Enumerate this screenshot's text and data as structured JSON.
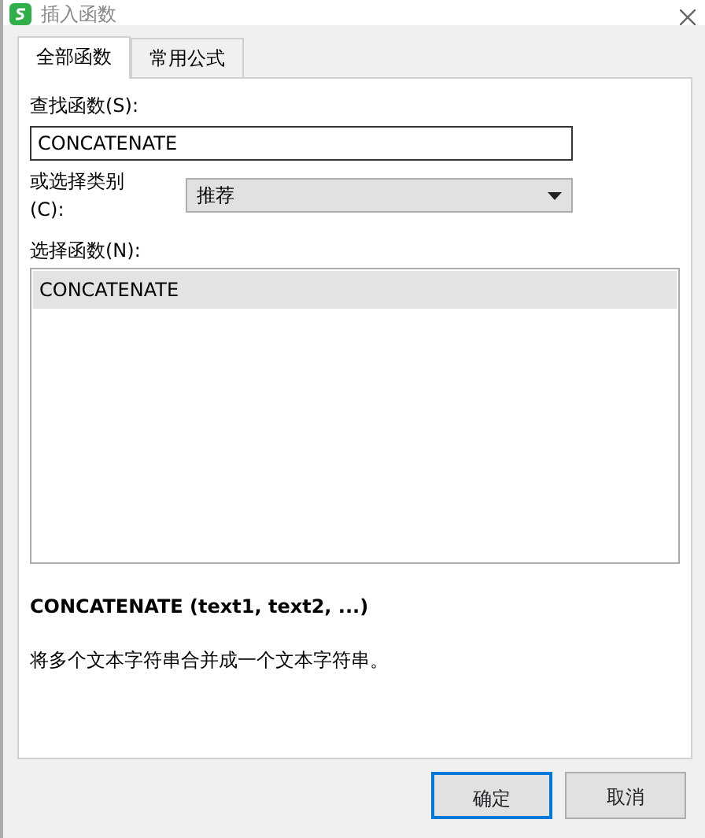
{
  "window": {
    "title": "插入函数"
  },
  "tabs": [
    {
      "label": "全部函数",
      "selected": true
    },
    {
      "label": "常用公式",
      "selected": false
    }
  ],
  "search": {
    "label": "查找函数(S):",
    "value": "CONCATENATE"
  },
  "category": {
    "label": "或选择类别(C):",
    "value": "推荐"
  },
  "functions": {
    "label": "选择函数(N):",
    "items": [
      {
        "name": "CONCATENATE",
        "selected": true
      }
    ]
  },
  "description": {
    "signature": "CONCATENATE (text1, text2, ...)",
    "text": "将多个文本字符串合并成一个文本字符串。"
  },
  "buttons": [
    {
      "label": "确定",
      "default": true
    },
    {
      "label": "取消",
      "default": false
    }
  ]
}
